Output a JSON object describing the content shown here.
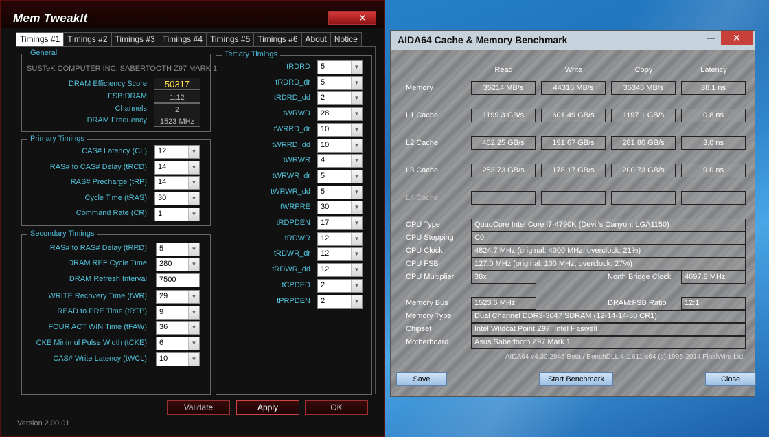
{
  "memtweakit": {
    "title": "Mem TweakIt",
    "minimize": "—",
    "close": "✕",
    "tabs": [
      "Timings #1",
      "Timings #2",
      "Timings #3",
      "Timings #4",
      "Timings #5",
      "Timings #6",
      "About",
      "Notice"
    ],
    "general": {
      "title": "General",
      "board": "SUSTeK COMPUTER INC. SABERTOOTH Z97 MARK 1",
      "efficiency_label": "DRAM Efficiency Score",
      "efficiency_value": "50317",
      "fsb_label": "FSB:DRAM",
      "fsb_value": "1:12",
      "channels_label": "Channels",
      "channels_value": "2",
      "freq_label": "DRAM Frequency",
      "freq_value": "1523 MHz"
    },
    "primary": {
      "title": "Primary Timings",
      "items": [
        {
          "label": "CAS# Latency (CL)",
          "value": "12"
        },
        {
          "label": "RAS# to CAS# Delay (tRCD)",
          "value": "14"
        },
        {
          "label": "RAS# Precharge (tRP)",
          "value": "14"
        },
        {
          "label": "Cycle Time (tRAS)",
          "value": "30"
        },
        {
          "label": "Command Rate (CR)",
          "value": "1"
        }
      ]
    },
    "secondary": {
      "title": "Secondary Timings",
      "items": [
        {
          "label": "RAS# to RAS# Delay (tRRD)",
          "value": "5"
        },
        {
          "label": "DRAM REF Cycle Time",
          "value": "280"
        },
        {
          "label": "DRAM Refresh Interval",
          "value": "7500"
        },
        {
          "label": "WRITE Recovery Time (tWR)",
          "value": "29"
        },
        {
          "label": "READ to PRE Time (tRTP)",
          "value": "9"
        },
        {
          "label": "FOUR ACT WIN Time (tFAW)",
          "value": "36"
        },
        {
          "label": "CKE Minimul Pulse Width (tCKE)",
          "value": "6"
        },
        {
          "label": "CAS# Write Latency (tWCL)",
          "value": "10"
        }
      ]
    },
    "tertiary": {
      "title": "Tertiary Timings",
      "items": [
        {
          "label": "tRDRD",
          "value": "5"
        },
        {
          "label": "tRDRD_dr",
          "value": "5"
        },
        {
          "label": "tRDRD_dd",
          "value": "2"
        },
        {
          "label": "tWRWD",
          "value": "28"
        },
        {
          "label": "tWRRD_dr",
          "value": "10"
        },
        {
          "label": "tWRRD_dd",
          "value": "10"
        },
        {
          "label": "tWRWR",
          "value": "4"
        },
        {
          "label": "tWRWR_dr",
          "value": "5"
        },
        {
          "label": "tWRWR_dd",
          "value": "5"
        },
        {
          "label": "tWRPRE",
          "value": "30"
        },
        {
          "label": "tRDPDEN",
          "value": "17"
        },
        {
          "label": "tRDWR",
          "value": "12"
        },
        {
          "label": "tRDWR_dr",
          "value": "12"
        },
        {
          "label": "tRDWR_dd",
          "value": "12"
        },
        {
          "label": "tCPDED",
          "value": "2"
        },
        {
          "label": "tPRPDEN",
          "value": "2"
        }
      ]
    },
    "buttons": {
      "validate": "Validate",
      "apply": "Apply",
      "ok": "OK"
    },
    "version": "Version 2.00.01"
  },
  "aida": {
    "title": "AIDA64 Cache & Memory Benchmark",
    "minimize": "—",
    "close": "✕",
    "headers": [
      "Read",
      "Write",
      "Copy",
      "Latency"
    ],
    "rows": [
      {
        "label": "Memory",
        "values": [
          "35214 MB/s",
          "44316 MB/s",
          "35345 MB/s",
          "38.1 ns"
        ]
      },
      {
        "label": "L1 Cache",
        "values": [
          "1199.3 GB/s",
          "601.49 GB/s",
          "1197.1 GB/s",
          "0.8 ns"
        ]
      },
      {
        "label": "L2 Cache",
        "values": [
          "462.25 GB/s",
          "191.67 GB/s",
          "281.80 GB/s",
          "3.0 ns"
        ]
      },
      {
        "label": "L3 Cache",
        "values": [
          "253.73 GB/s",
          "178.17 GB/s",
          "200.73 GB/s",
          "9.0 ns"
        ]
      },
      {
        "label": "L4 Cache",
        "values": [
          "",
          "",
          "",
          ""
        ]
      }
    ],
    "info": {
      "cpu_type_label": "CPU Type",
      "cpu_type": "QuadCore Intel Core i7-4790K  (Devil's Canyon, LGA1150)",
      "cpu_stepping_label": "CPU Stepping",
      "cpu_stepping": "C0",
      "cpu_clock_label": "CPU Clock",
      "cpu_clock": "4824.7 MHz  (original: 4000 MHz, overclock: 21%)",
      "cpu_fsb_label": "CPU FSB",
      "cpu_fsb": "127.0 MHz  (original: 100 MHz, overclock: 27%)",
      "cpu_mult_label": "CPU Multiplier",
      "cpu_mult": "38x",
      "nb_clock_label": "North Bridge Clock",
      "nb_clock": "4697.8 MHz",
      "mem_bus_label": "Memory Bus",
      "mem_bus": "1523.6 MHz",
      "dram_fsb_label": "DRAM:FSB Ratio",
      "dram_fsb": "12:1",
      "mem_type_label": "Memory Type",
      "mem_type": "Dual Channel DDR3-3047 SDRAM  (12-14-14-30 CR1)",
      "chipset_label": "Chipset",
      "chipset": "Intel Wildcat Point Z97, Intel Haswell",
      "mobo_label": "Motherboard",
      "mobo": "Asus Sabertooth Z97 Mark 1"
    },
    "footer": "AIDA64 v4.30.2946 Beta / BenchDLL 4.1.611-x64  (c) 1995-2014 FinalWire Ltd.",
    "buttons": {
      "save": "Save",
      "start": "Start Benchmark",
      "close": "Close"
    }
  }
}
